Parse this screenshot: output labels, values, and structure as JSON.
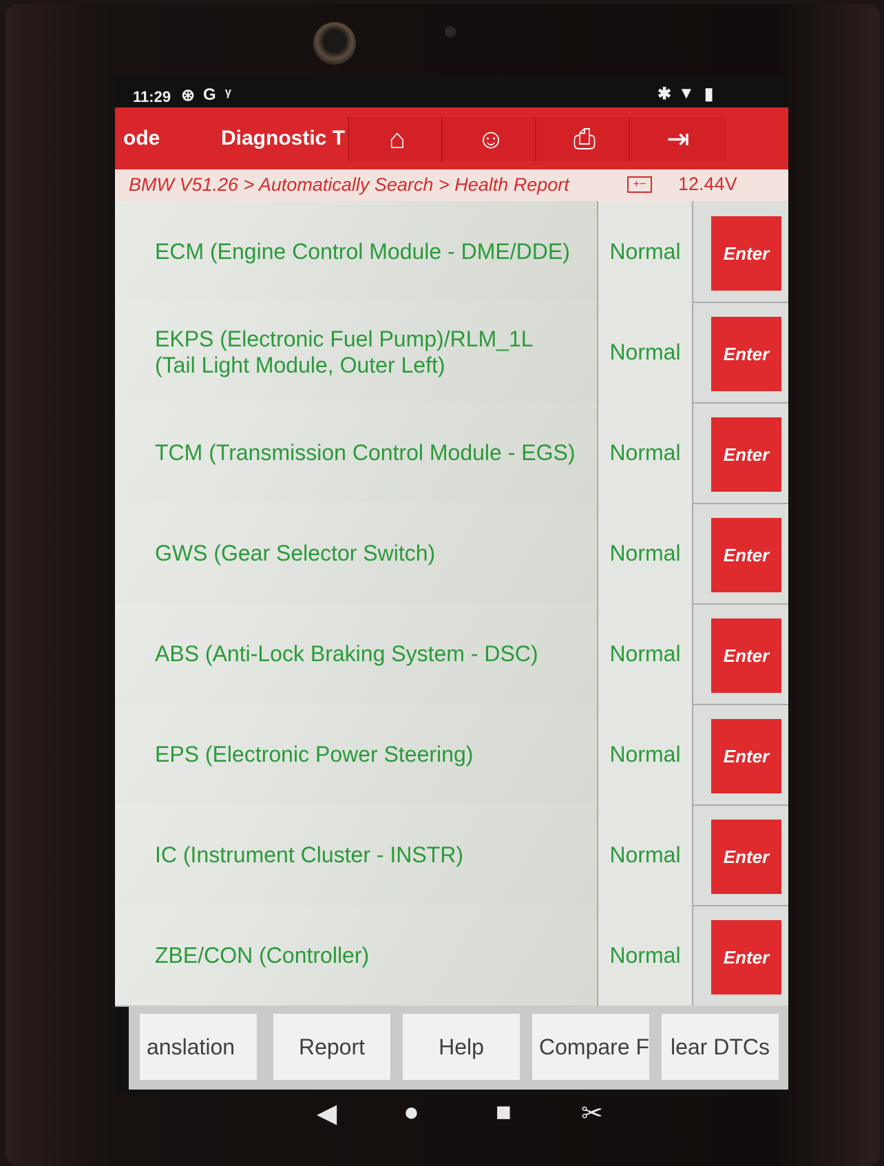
{
  "status_bar": {
    "time": "11:29"
  },
  "app_bar": {
    "tab_left": "ode",
    "tab_title": "Diagnostic T",
    "buttons": [
      "home-icon",
      "support-icon",
      "print-icon",
      "exit-icon"
    ]
  },
  "breadcrumb": {
    "path": "BMW V51.26 > Automatically Search > Health Report",
    "voltage": "12.44V"
  },
  "modules": [
    {
      "name": "ECM (Engine Control Module - DME/DDE)",
      "status": "Normal",
      "action": "Enter"
    },
    {
      "name": "EKPS (Electronic Fuel Pump)/RLM_1L (Tail Light Module, Outer Left)",
      "status": "Normal",
      "action": "Enter"
    },
    {
      "name": "TCM (Transmission Control Module - EGS)",
      "status": "Normal",
      "action": "Enter"
    },
    {
      "name": "GWS (Gear Selector Switch)",
      "status": "Normal",
      "action": "Enter"
    },
    {
      "name": "ABS (Anti-Lock Braking System - DSC)",
      "status": "Normal",
      "action": "Enter"
    },
    {
      "name": "EPS (Electronic Power Steering)",
      "status": "Normal",
      "action": "Enter"
    },
    {
      "name": "IC (Instrument Cluster - INSTR)",
      "status": "Normal",
      "action": "Enter"
    },
    {
      "name": "ZBE/CON (Controller)",
      "status": "Normal",
      "action": "Enter"
    }
  ],
  "toolbar": {
    "translation": "anslation",
    "report": "Report",
    "help": "Help",
    "compare": "Compare F",
    "clear_dtcs": "lear DTCs"
  },
  "colors": {
    "brand_red": "#d9262a",
    "status_green": "#2a9a3a",
    "breadcrumb_bg": "#f3e3df"
  }
}
